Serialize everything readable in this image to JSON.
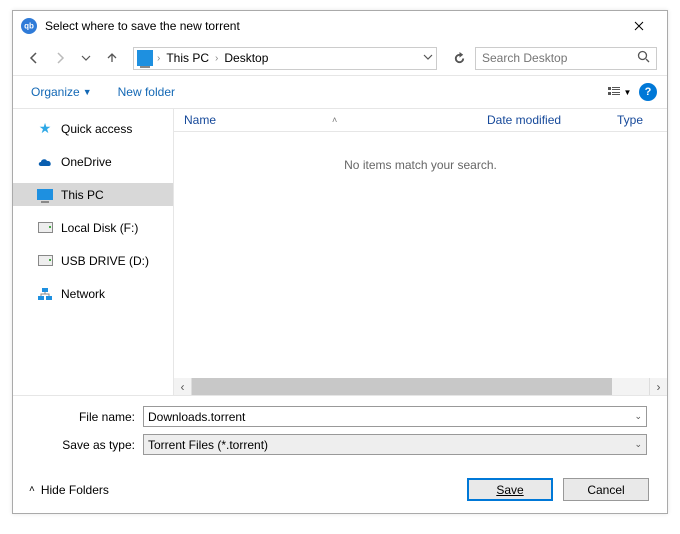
{
  "window": {
    "title": "Select where to save the new torrent"
  },
  "nav": {
    "breadcrumbs": [
      "This PC",
      "Desktop"
    ],
    "search_placeholder": "Search Desktop"
  },
  "toolbar": {
    "organize": "Organize",
    "newfolder": "New folder"
  },
  "sidebar": {
    "items": [
      {
        "label": "Quick access"
      },
      {
        "label": "OneDrive"
      },
      {
        "label": "This PC"
      },
      {
        "label": "Local Disk (F:)"
      },
      {
        "label": "USB DRIVE (D:)"
      },
      {
        "label": "Network"
      }
    ]
  },
  "columns": {
    "name": "Name",
    "date": "Date modified",
    "type": "Type"
  },
  "empty_message": "No items match your search.",
  "form": {
    "filename_label": "File name:",
    "filename_value": "Downloads.torrent",
    "saveastype_label": "Save as type:",
    "saveastype_value": "Torrent Files (*.torrent)"
  },
  "footer": {
    "hide_folders": "Hide Folders",
    "save": "Save",
    "cancel": "Cancel"
  }
}
